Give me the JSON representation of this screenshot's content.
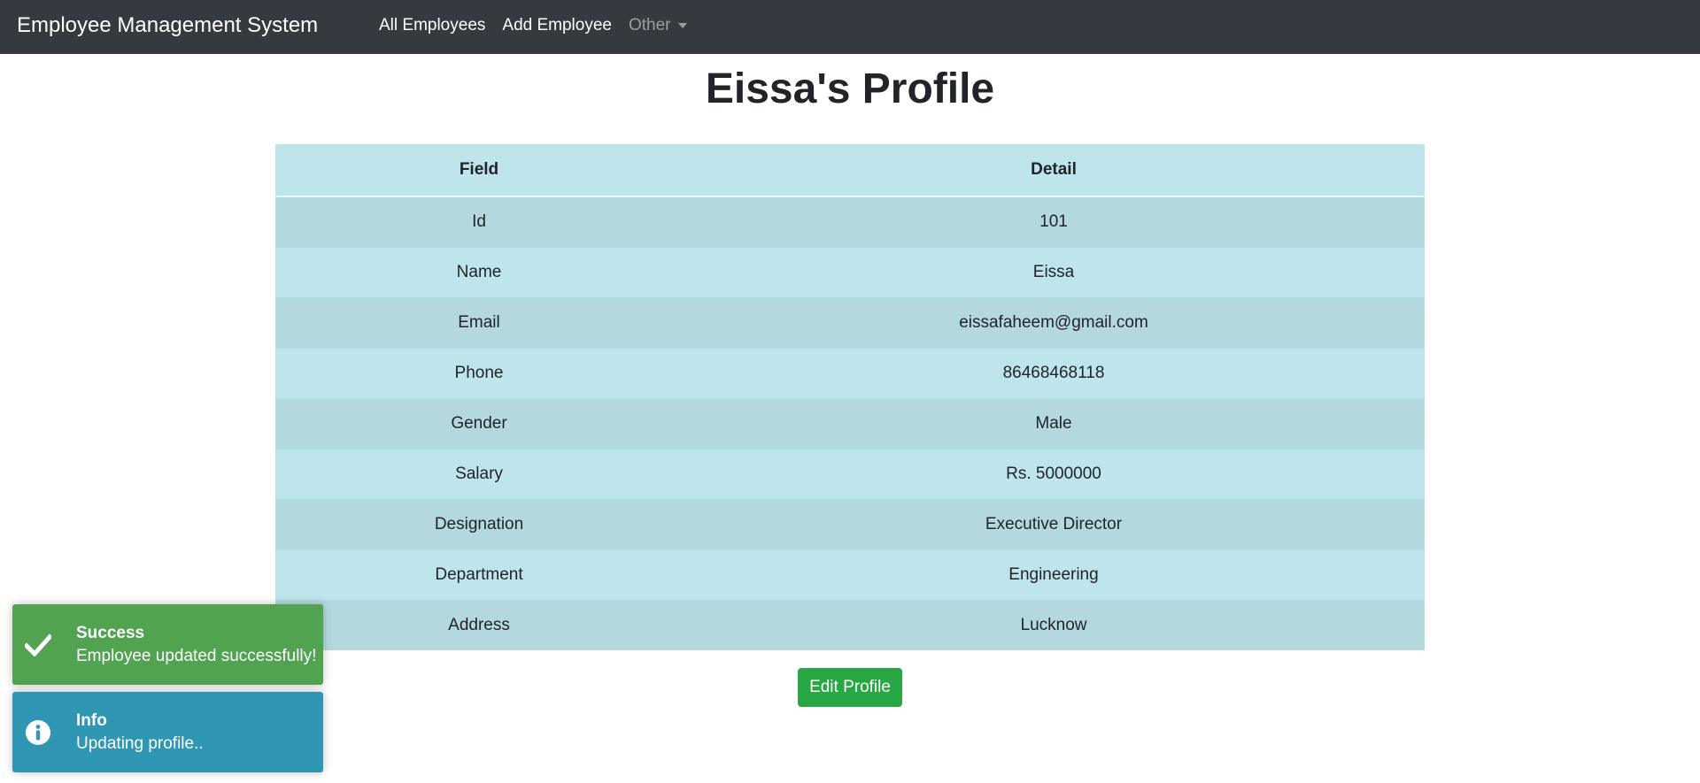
{
  "navbar": {
    "brand": "Employee Management System",
    "links": [
      "All Employees",
      "Add Employee"
    ],
    "dropdown_label": "Other"
  },
  "page": {
    "title": "Eissa's Profile"
  },
  "table": {
    "headers": [
      "Field",
      "Detail"
    ],
    "rows": [
      {
        "field": "Id",
        "detail": "101"
      },
      {
        "field": "Name",
        "detail": "Eissa"
      },
      {
        "field": "Email",
        "detail": "eissafaheem@gmail.com"
      },
      {
        "field": "Phone",
        "detail": "86468468118"
      },
      {
        "field": "Gender",
        "detail": "Male"
      },
      {
        "field": "Salary",
        "detail": "Rs. 5000000"
      },
      {
        "field": "Designation",
        "detail": "Executive Director"
      },
      {
        "field": "Department",
        "detail": "Engineering"
      },
      {
        "field": "Address",
        "detail": "Lucknow"
      }
    ]
  },
  "actions": {
    "edit_label": "Edit Profile"
  },
  "toasts": [
    {
      "type": "success",
      "icon": "check-icon",
      "title": "Success",
      "message": "Employee updated successfully!",
      "color": "#51a351"
    },
    {
      "type": "info",
      "icon": "info-icon",
      "title": "Info",
      "message": "Updating profile..",
      "color": "#2f96b4"
    }
  ],
  "colors": {
    "navbar": "#343a40",
    "table_header": "#bee5eb",
    "table_row_dark": "#b3d9df",
    "button_success": "#28a745"
  }
}
